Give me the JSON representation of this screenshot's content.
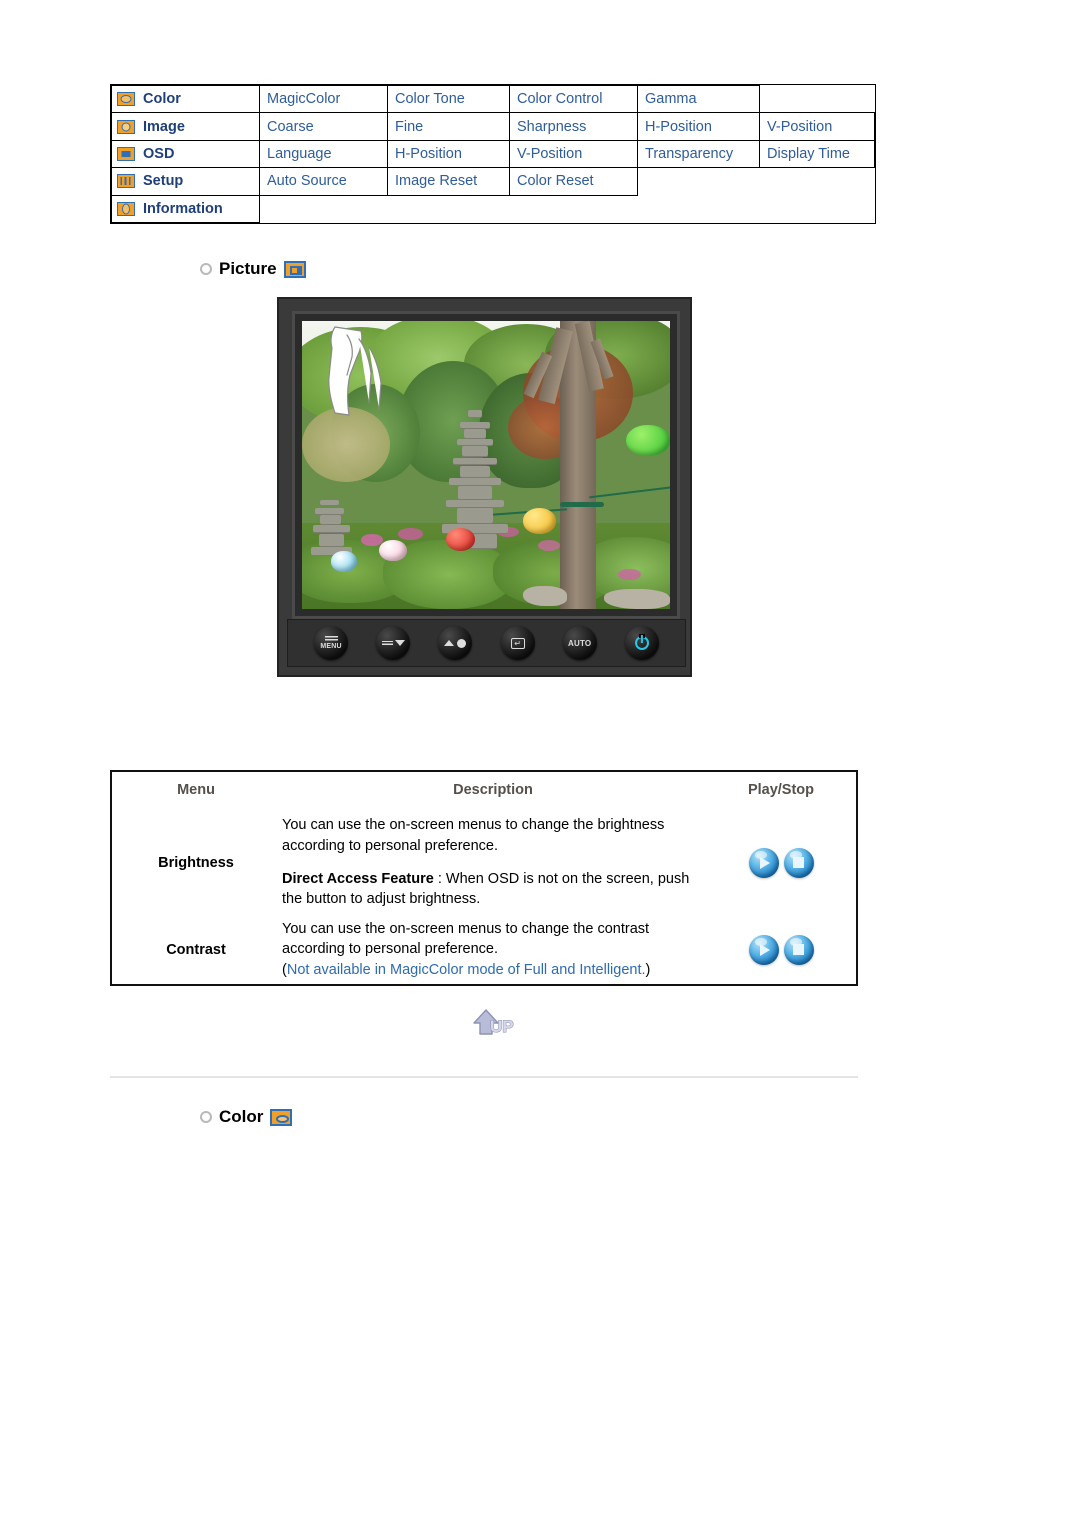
{
  "menu_map": {
    "rows": [
      {
        "icon": "color-icon",
        "category": "Color",
        "items": [
          "MagicColor",
          "Color Tone",
          "Color Control",
          "Gamma"
        ]
      },
      {
        "icon": "image-icon",
        "category": "Image",
        "items": [
          "Coarse",
          "Fine",
          "Sharpness",
          "H-Position",
          "V-Position"
        ]
      },
      {
        "icon": "osd-icon",
        "category": "OSD",
        "items": [
          "Language",
          "H-Position",
          "V-Position",
          "Transparency",
          "Display Time"
        ]
      },
      {
        "icon": "setup-icon",
        "category": "Setup",
        "items": [
          "Auto Source",
          "Image Reset",
          "Color Reset"
        ]
      },
      {
        "icon": "information-icon",
        "category": "Information",
        "items": []
      }
    ]
  },
  "sections": {
    "picture": {
      "title": "Picture",
      "icon": "picture-osd-icon"
    },
    "color": {
      "title": "Color",
      "icon": "color-osd-icon"
    }
  },
  "monitor": {
    "photo_alt": "Korean garden with stone pagoda, trees and colored paper lanterns",
    "buttons": [
      {
        "name": "menu-button",
        "label": "MENU"
      },
      {
        "name": "down-button",
        "label": ""
      },
      {
        "name": "brightness-button",
        "label": ""
      },
      {
        "name": "enter-source-button",
        "label": ""
      },
      {
        "name": "auto-button",
        "label": "AUTO"
      },
      {
        "name": "power-button",
        "label": ""
      }
    ]
  },
  "description_table": {
    "headers": {
      "menu": "Menu",
      "description": "Description",
      "play_stop": "Play/Stop"
    },
    "rows": [
      {
        "menu": "Brightness",
        "paragraphs": [
          {
            "text": "You can use the on-screen menus to change the brightness according to personal preference."
          },
          {
            "strong": "Direct Access Feature",
            "text": " : When OSD is not on the screen, push the button to adjust brightness."
          }
        ],
        "note": "",
        "play_label": "Play",
        "stop_label": "Stop"
      },
      {
        "menu": "Contrast",
        "paragraphs": [
          {
            "text": "You can use the on-screen menus to change the contrast according to personal preference."
          }
        ],
        "note_open": "(",
        "note": "Not available in MagicColor mode of Full and Intelligent.",
        "note_close": ")",
        "play_label": "Play",
        "stop_label": "Stop"
      }
    ]
  },
  "up_button": {
    "label": "UP"
  },
  "colors": {
    "link_blue": "#2e5c9a",
    "category_blue": "#1f3f7a",
    "note_blue": "#2e6bb0",
    "header_grey": "#55504c",
    "icon_orange": "#f0a028",
    "icon_border_blue": "#2f6fb5",
    "power_cyan": "#25c8e8",
    "divider_grey": "#e4e4e4"
  }
}
